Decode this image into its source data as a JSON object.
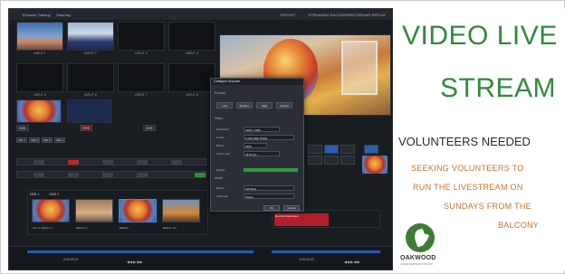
{
  "app": {
    "title": "TriCaster Training",
    "session": "Saturday",
    "top_right": [
      "EXPORT",
      "STREAMING ENCODER",
      "RECORDING REPLAY"
    ],
    "inputs_row1": [
      "INPUT 1",
      "INPUT 2",
      "INPUT 3",
      "INPUT 4"
    ],
    "inputs_row2": [
      "INPUT 5",
      "INPUT 6",
      "INPUT 7",
      "INPUT 8"
    ],
    "controls": [
      "DDR",
      "FIRE",
      "DDR"
    ],
    "bus_tabs": [
      "M/E 1",
      "M/E 2",
      "M/E 3",
      "M/E 4"
    ],
    "media_tabs": [
      "DDR 1",
      "DDR 2"
    ],
    "media_items": [
      "Hot Air Balloon 1",
      "Balloon 2",
      "Balloon",
      "Balloon Fly"
    ],
    "playlist_item": "Red and Apparatus",
    "transport_left": "◀◀  ▶  ▶▶",
    "transport_right": "◀◀  ▶  ▶▶",
    "timecode_left": "0:00:00.00",
    "timecode_right": "0:00:00.00"
  },
  "dialog": {
    "title": "Configure Encoder",
    "section1": "Presets",
    "tabs": [
      "Low",
      "Medium",
      "High",
      "Custom"
    ],
    "section2": "Video",
    "resolution_label": "Resolution",
    "resolution_value": "1920 × 1080",
    "codec_label": "Codec",
    "codec_value": "H.264 High Profile",
    "bitrate_label": "Bitrate",
    "bitrate_value": "4000",
    "framerate_label": "Frame rate",
    "framerate_value": "29.97 fps",
    "quality_label": "Quality",
    "section3": "Audio",
    "audio_label": "Bitrate",
    "audio_value": "128 kbps",
    "channels_label": "Channels",
    "channels_value": "Stereo",
    "ok_label": "OK",
    "cancel_label": "Cancel"
  },
  "flyer": {
    "line1": "VIDEO LIVE",
    "line2": "STREAM",
    "subhead": "VOLUNTEERS NEEDED",
    "body": [
      "SEEKING VOLUNTEERS  TO",
      "RUN THE LIVESTREAM ON",
      "SUNDAYS FROM THE",
      "BALCONY"
    ],
    "logo_text": "OAKWOOD",
    "logo_sub": "UNITED METHODIST CHURCH"
  },
  "colors": {
    "headline_green": "#2f8a3c",
    "body_orange": "#c8742a",
    "app_bg": "#1a1d22",
    "tally_red": "#c0262b",
    "tally_green": "#2f8f39",
    "accent_blue": "#1f5fb8"
  }
}
